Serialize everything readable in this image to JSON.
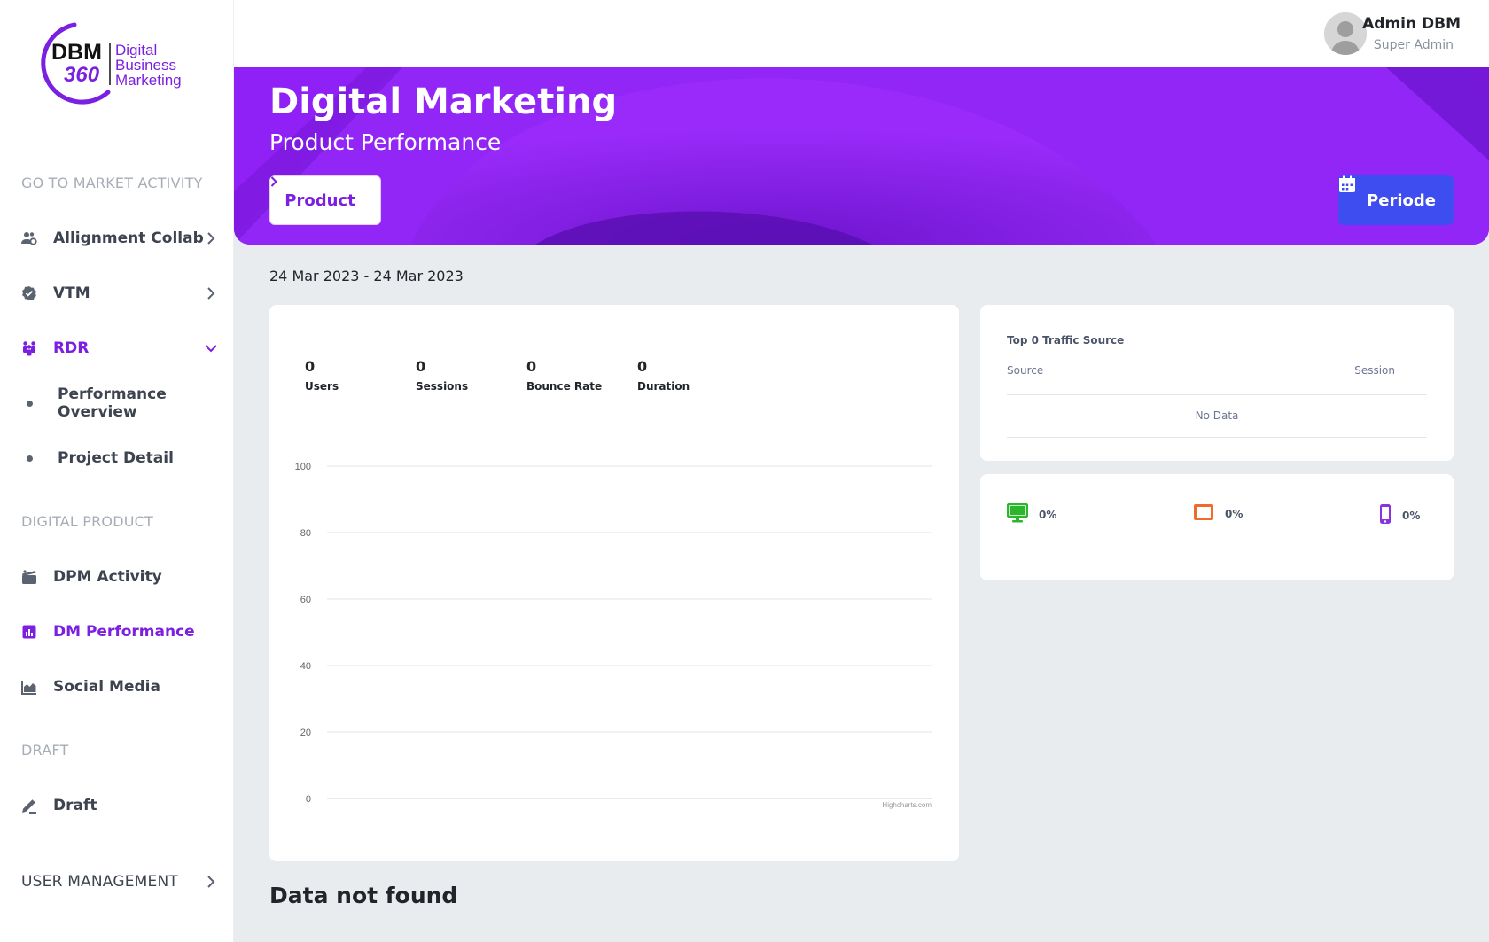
{
  "brand": {
    "logo_mark_top": "DBM",
    "logo_mark_bottom": "360",
    "logo_line1": "Digital",
    "logo_line2": "Business",
    "logo_line3": "Marketing"
  },
  "sidebar": {
    "sections": {
      "go_to_market": "GO TO MARKET ACTIVITY",
      "digital_product": "DIGITAL PRODUCT",
      "draft": "DRAFT"
    },
    "items": {
      "allignment": "Allignment Collab",
      "vtm": "VTM",
      "rdr": "RDR",
      "performance_overview": "Performance Overview",
      "project_detail": "Project Detail",
      "dpm_activity": "DPM Activity",
      "dm_performance": "DM Performance",
      "social_media": "Social Media",
      "draft": "Draft",
      "user_management": "USER MANAGEMENT"
    },
    "active_color": "#7b1fe0"
  },
  "user": {
    "name": "Admin DBM",
    "role": "Super Admin"
  },
  "hero": {
    "title": "Digital Marketing",
    "subtitle": "Product Performance",
    "product_button": "Product",
    "periode_button": "Periode",
    "bg_color": "#8f20f6",
    "periode_color": "#3d4df0"
  },
  "date_range": "24 Mar 2023 - 24 Mar 2023",
  "metrics": [
    {
      "value": "0",
      "label": "Users"
    },
    {
      "value": "0",
      "label": "Sessions"
    },
    {
      "value": "0",
      "label": "Bounce Rate"
    },
    {
      "value": "0",
      "label": "Duration"
    }
  ],
  "chart_data": {
    "type": "line",
    "series": [],
    "x": [],
    "yticks": [
      "100",
      "80",
      "60",
      "40",
      "20",
      "0"
    ],
    "ylim": [
      0,
      100
    ],
    "grid": true,
    "credit": "Highcharts.com"
  },
  "traffic": {
    "title": "Top 0 Traffic Source",
    "col_source": "Source",
    "col_session": "Session",
    "empty": "No Data"
  },
  "devices": [
    {
      "icon": "desktop-icon",
      "pct": "0%",
      "color": "#2bb62b"
    },
    {
      "icon": "tablet-icon",
      "pct": "0%",
      "color": "#f06a28"
    },
    {
      "icon": "mobile-icon",
      "pct": "0%",
      "color": "#8a32e0"
    }
  ],
  "not_found": "Data not found"
}
